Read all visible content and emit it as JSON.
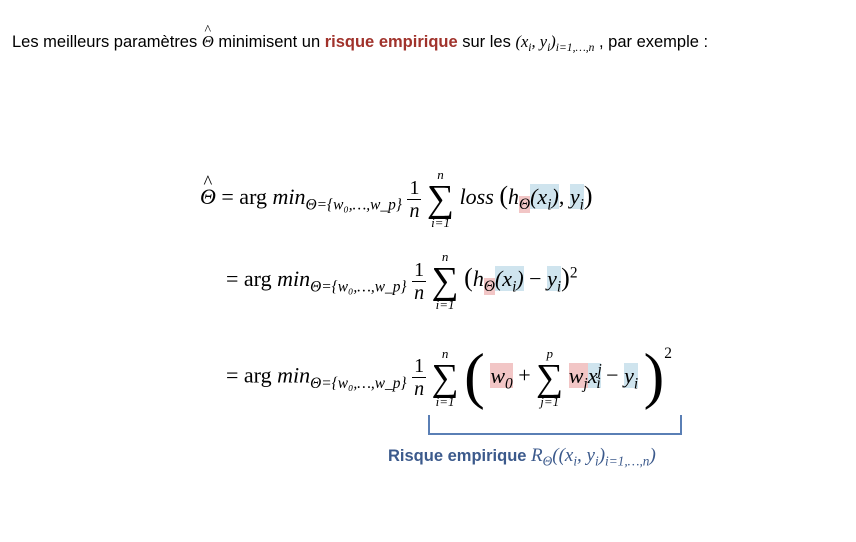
{
  "intro": {
    "before": "Les meilleurs paramètres ",
    "theta_hat": "Θ",
    "middle": " minimisent un ",
    "highlight": "risque empirique",
    "after_highlight": " sur les ",
    "pairs": "(x",
    "pairs_i": "i",
    "pairs_y": ", y",
    "pairs_close": ")",
    "pairs_sub": "i=1,…,n",
    "end": " , par exemple :"
  },
  "equations": {
    "lhs": "Θ",
    "eq": " = arg ",
    "min": "min",
    "min_sub": "Θ={w₀,…,w_p}",
    "frac_num": "1",
    "frac_den": "n",
    "sum_top": "n",
    "sum_bot": "i=1",
    "sum_top_inner": "p",
    "sum_bot_inner": "j=1",
    "loss": "loss",
    "exponent": "2"
  },
  "caption": {
    "label": "Risque empirique ",
    "formula": "R",
    "formula_sub": "Θ",
    "formula_args": "((x",
    "formula_i": "i",
    "formula_y": ", y",
    "formula_close": ")",
    "formula_range": "i=1,…,n",
    "formula_end": ")"
  },
  "colors": {
    "highlight_text": "#a0322b",
    "caption_text": "#3c5a8c",
    "bracket": "#5a7fb5",
    "red_box": "#f2c6c6",
    "blue_box": "#cfe4ee"
  }
}
